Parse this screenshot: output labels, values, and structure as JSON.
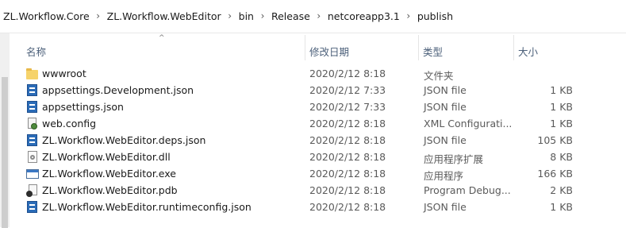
{
  "breadcrumb": [
    "ZL.Workflow.Core",
    "ZL.Workflow.WebEditor",
    "bin",
    "Release",
    "netcoreapp3.1",
    "publish"
  ],
  "columns": {
    "name": "名称",
    "modified": "修改日期",
    "type": "类型",
    "size": "大小"
  },
  "sort_indicator": "^",
  "files": [
    {
      "icon": "folder-icon",
      "name": "wwwroot",
      "modified": "2020/2/12 8:18",
      "type": "文件夹",
      "size": ""
    },
    {
      "icon": "json-file-icon",
      "name": "appsettings.Development.json",
      "modified": "2020/2/12 7:33",
      "type": "JSON file",
      "size": "1 KB"
    },
    {
      "icon": "json-file-icon",
      "name": "appsettings.json",
      "modified": "2020/2/12 7:33",
      "type": "JSON file",
      "size": "1 KB"
    },
    {
      "icon": "config-file-icon",
      "name": "web.config",
      "modified": "2020/2/12 8:18",
      "type": "XML Configurati...",
      "size": "1 KB"
    },
    {
      "icon": "json-file-icon",
      "name": "ZL.Workflow.WebEditor.deps.json",
      "modified": "2020/2/12 8:18",
      "type": "JSON file",
      "size": "105 KB"
    },
    {
      "icon": "dll-file-icon",
      "name": "ZL.Workflow.WebEditor.dll",
      "modified": "2020/2/12 8:18",
      "type": "应用程序扩展",
      "size": "8 KB"
    },
    {
      "icon": "exe-file-icon",
      "name": "ZL.Workflow.WebEditor.exe",
      "modified": "2020/2/12 8:18",
      "type": "应用程序",
      "size": "166 KB"
    },
    {
      "icon": "pdb-file-icon",
      "name": "ZL.Workflow.WebEditor.pdb",
      "modified": "2020/2/12 8:18",
      "type": "Program Debug...",
      "size": "2 KB"
    },
    {
      "icon": "json-file-icon",
      "name": "ZL.Workflow.WebEditor.runtimeconfig.json",
      "modified": "2020/2/12 8:18",
      "type": "JSON file",
      "size": "1 KB"
    }
  ]
}
